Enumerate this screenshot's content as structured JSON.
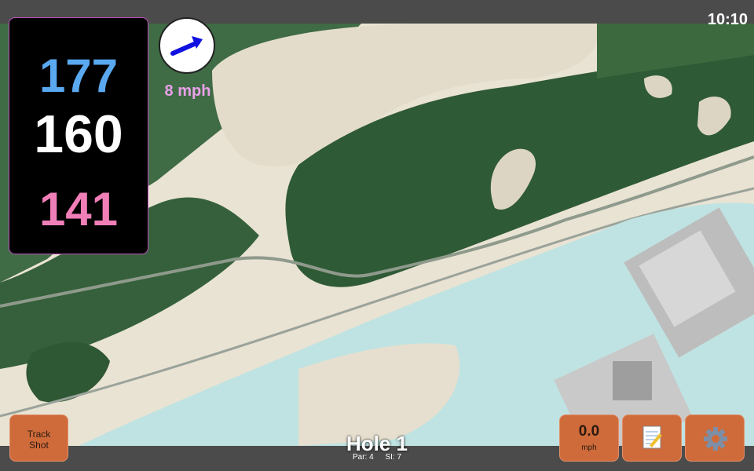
{
  "status_bar": {
    "time": "10:10"
  },
  "distances": {
    "back": "177",
    "middle": "160",
    "front": "141",
    "colors": {
      "back": "#5aa9f0",
      "middle": "#ffffff",
      "front": "#f07fb8"
    }
  },
  "wind": {
    "speed": "8 mph",
    "arrow_icon": "wind-arrow-icon",
    "speed_color": "#e9a0e9"
  },
  "buttons": {
    "track_shot_line1": "Track",
    "track_shot_line2": "Shot",
    "speed_value": "0.0",
    "speed_unit": "mph",
    "notes_icon": "notepad-icon",
    "settings_icon": "gear-icon",
    "accent": "#cf6b3a"
  },
  "hole": {
    "title": "Hole 1",
    "par": "Par: 4",
    "si": "SI: 7"
  },
  "map": {
    "type": "satellite-course-view"
  }
}
